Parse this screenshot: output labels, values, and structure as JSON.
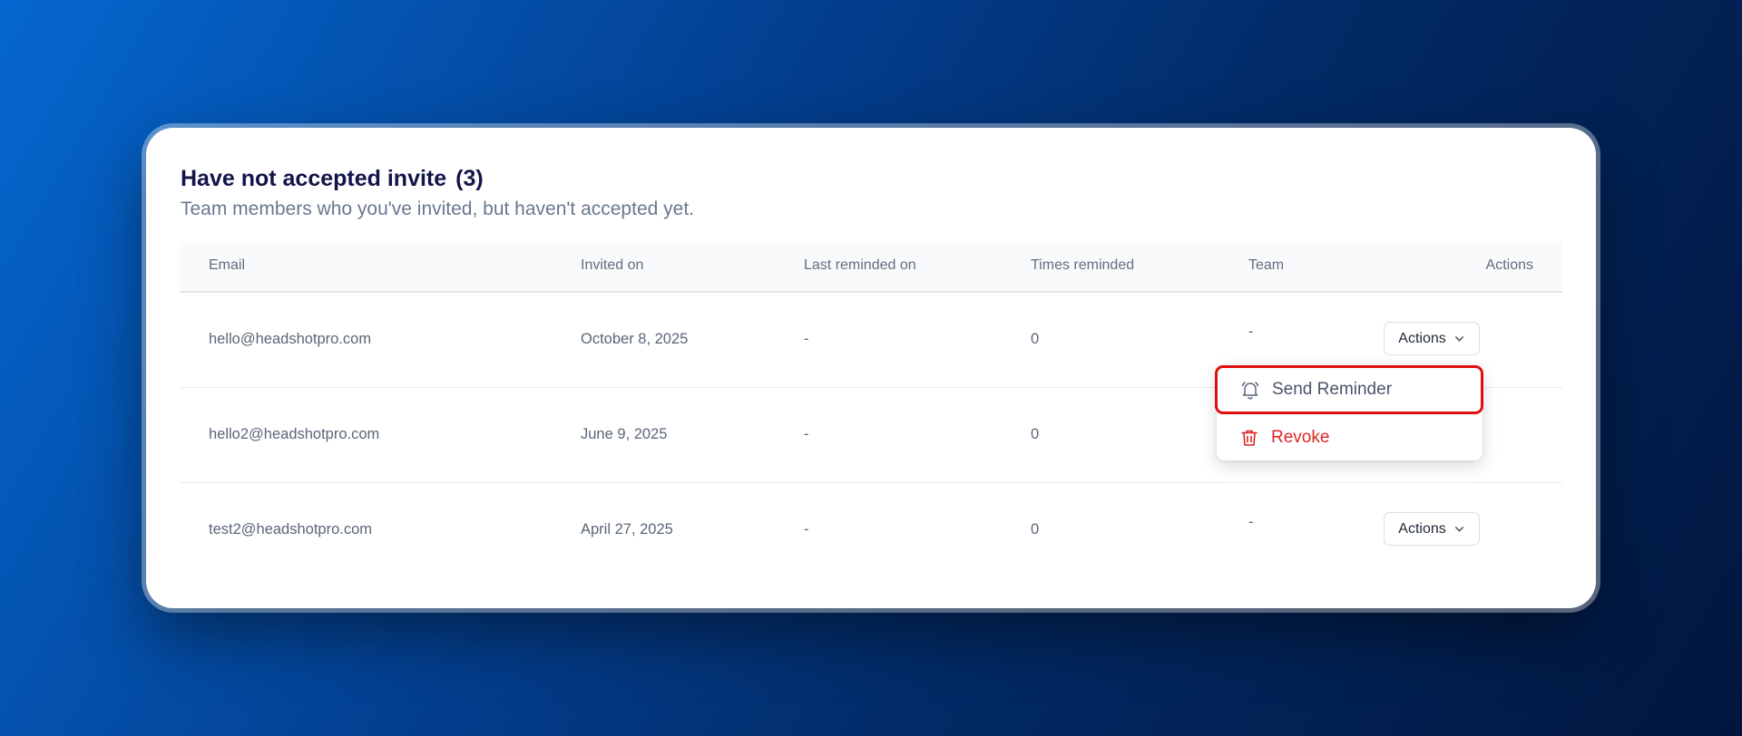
{
  "section": {
    "title": "Have not accepted invite",
    "count": "(3)",
    "subtitle": "Team members who you've invited, but haven't accepted yet."
  },
  "table": {
    "columns": [
      "Email",
      "Invited on",
      "Last reminded on",
      "Times reminded",
      "Team",
      "Actions"
    ],
    "rows": [
      {
        "email": "hello@headshotpro.com",
        "invited_on": "October 8, 2025",
        "last_reminded": "-",
        "times": "0",
        "team": "-",
        "actions": "Actions"
      },
      {
        "email": "hello2@headshotpro.com",
        "invited_on": "June 9, 2025",
        "last_reminded": "-",
        "times": "0",
        "team": "",
        "actions": ""
      },
      {
        "email": "test2@headshotpro.com",
        "invited_on": "April 27, 2025",
        "last_reminded": "-",
        "times": "0",
        "team": "-",
        "actions": "Actions"
      }
    ]
  },
  "menu": {
    "items": [
      {
        "label": "Send Reminder",
        "icon": "bell-icon"
      },
      {
        "label": "Revoke",
        "icon": "trash-icon"
      }
    ]
  },
  "colors": {
    "title": "#12154a",
    "danger": "#dc2626",
    "highlight_border": "#e10e0e"
  }
}
